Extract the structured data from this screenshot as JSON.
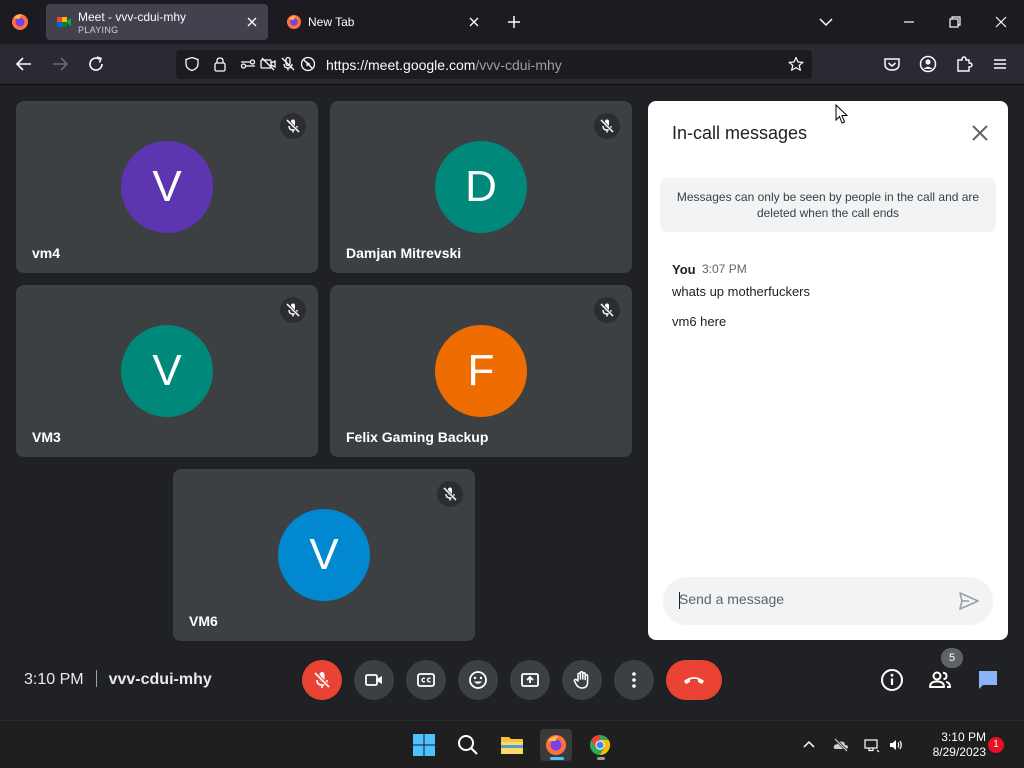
{
  "browser": {
    "tabs": [
      {
        "title": "Meet - vvv-cdui-mhy",
        "status": "PLAYING",
        "active": true
      },
      {
        "title": "New Tab",
        "active": false
      }
    ],
    "url": {
      "host": "https://meet.google.com",
      "path": "/vvv-cdui-mhy"
    }
  },
  "participants": [
    {
      "initial": "V",
      "name": "vm4",
      "color": "#5e35b1",
      "muted": true
    },
    {
      "initial": "D",
      "name": "Damjan Mitrevski",
      "color": "#00897b",
      "muted": true
    },
    {
      "initial": "V",
      "name": "VM3",
      "color": "#00897b",
      "muted": true
    },
    {
      "initial": "F",
      "name": "Felix Gaming Backup",
      "color": "#ef6c00",
      "muted": true
    },
    {
      "initial": "V",
      "name": "VM6",
      "color": "#0288d1",
      "muted": true
    }
  ],
  "chat": {
    "title": "In-call messages",
    "notice": "Messages can only be seen by people in the call and are deleted when the call ends",
    "messages": {
      "sender": "You",
      "time": "3:07 PM",
      "lines": [
        "whats up motherfuckers",
        "vm6 here"
      ]
    },
    "input_placeholder": "Send a message"
  },
  "controls": {
    "time": "3:10 PM",
    "meeting_code": "vvv-cdui-mhy",
    "people_count": "5"
  },
  "taskbar": {
    "time": "3:10 PM",
    "date": "8/29/2023",
    "notifications": "1"
  }
}
